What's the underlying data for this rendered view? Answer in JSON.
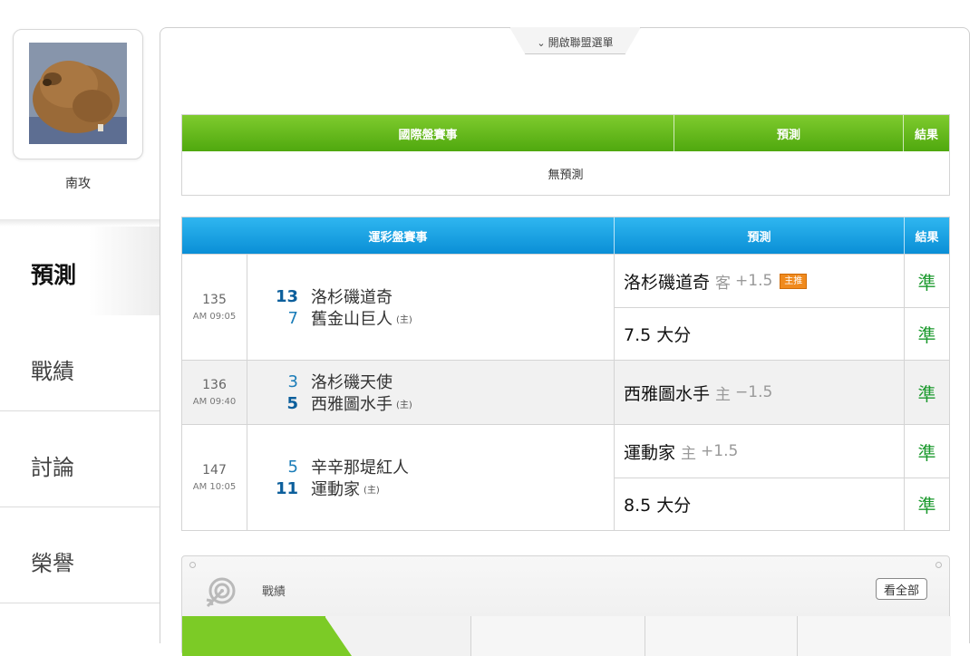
{
  "user": {
    "name": "南攻"
  },
  "nav": [
    "預測",
    "戰績",
    "討論",
    "榮譽"
  ],
  "league_toggle": "開啟聯盟選單",
  "intl": {
    "headers": [
      "國際盤賽事",
      "預測",
      "結果"
    ],
    "empty": "無預測"
  },
  "lottery": {
    "headers": [
      "運彩盤賽事",
      "預測",
      "結果"
    ],
    "home_marker": "(主)",
    "games": [
      {
        "no": "135",
        "time": "AM 09:05",
        "teams": [
          {
            "score": "13",
            "name": "洛杉磯道奇"
          },
          {
            "score": "7",
            "name": "舊金山巨人"
          }
        ],
        "picks": [
          {
            "team": "洛杉磯道奇",
            "side": "客",
            "line": "+1.5",
            "badge": "主推",
            "result": "準"
          },
          {
            "team": "7.5 大分",
            "side": "",
            "line": "",
            "badge": "",
            "result": "準"
          }
        ]
      },
      {
        "no": "136",
        "time": "AM 09:40",
        "teams": [
          {
            "score": "3",
            "name": "洛杉磯天使"
          },
          {
            "score": "5",
            "name": "西雅圖水手"
          }
        ],
        "picks": [
          {
            "team": "西雅圖水手",
            "side": "主",
            "line": "−1.5",
            "badge": "",
            "result": "準"
          }
        ]
      },
      {
        "no": "147",
        "time": "AM 10:05",
        "teams": [
          {
            "score": "5",
            "name": "辛辛那堤紅人"
          },
          {
            "score": "11",
            "name": "運動家"
          }
        ],
        "picks": [
          {
            "team": "運動家",
            "side": "主",
            "line": "+1.5",
            "badge": "",
            "result": "準"
          },
          {
            "team": "8.5 大分",
            "side": "",
            "line": "",
            "badge": "",
            "result": "準"
          }
        ]
      }
    ]
  },
  "record": {
    "title": "戰績",
    "view_all": "看全部"
  },
  "colors": {
    "green_header": "#5cb518",
    "blue_header": "#1aa3e6",
    "result_green": "#1c9a2e"
  }
}
